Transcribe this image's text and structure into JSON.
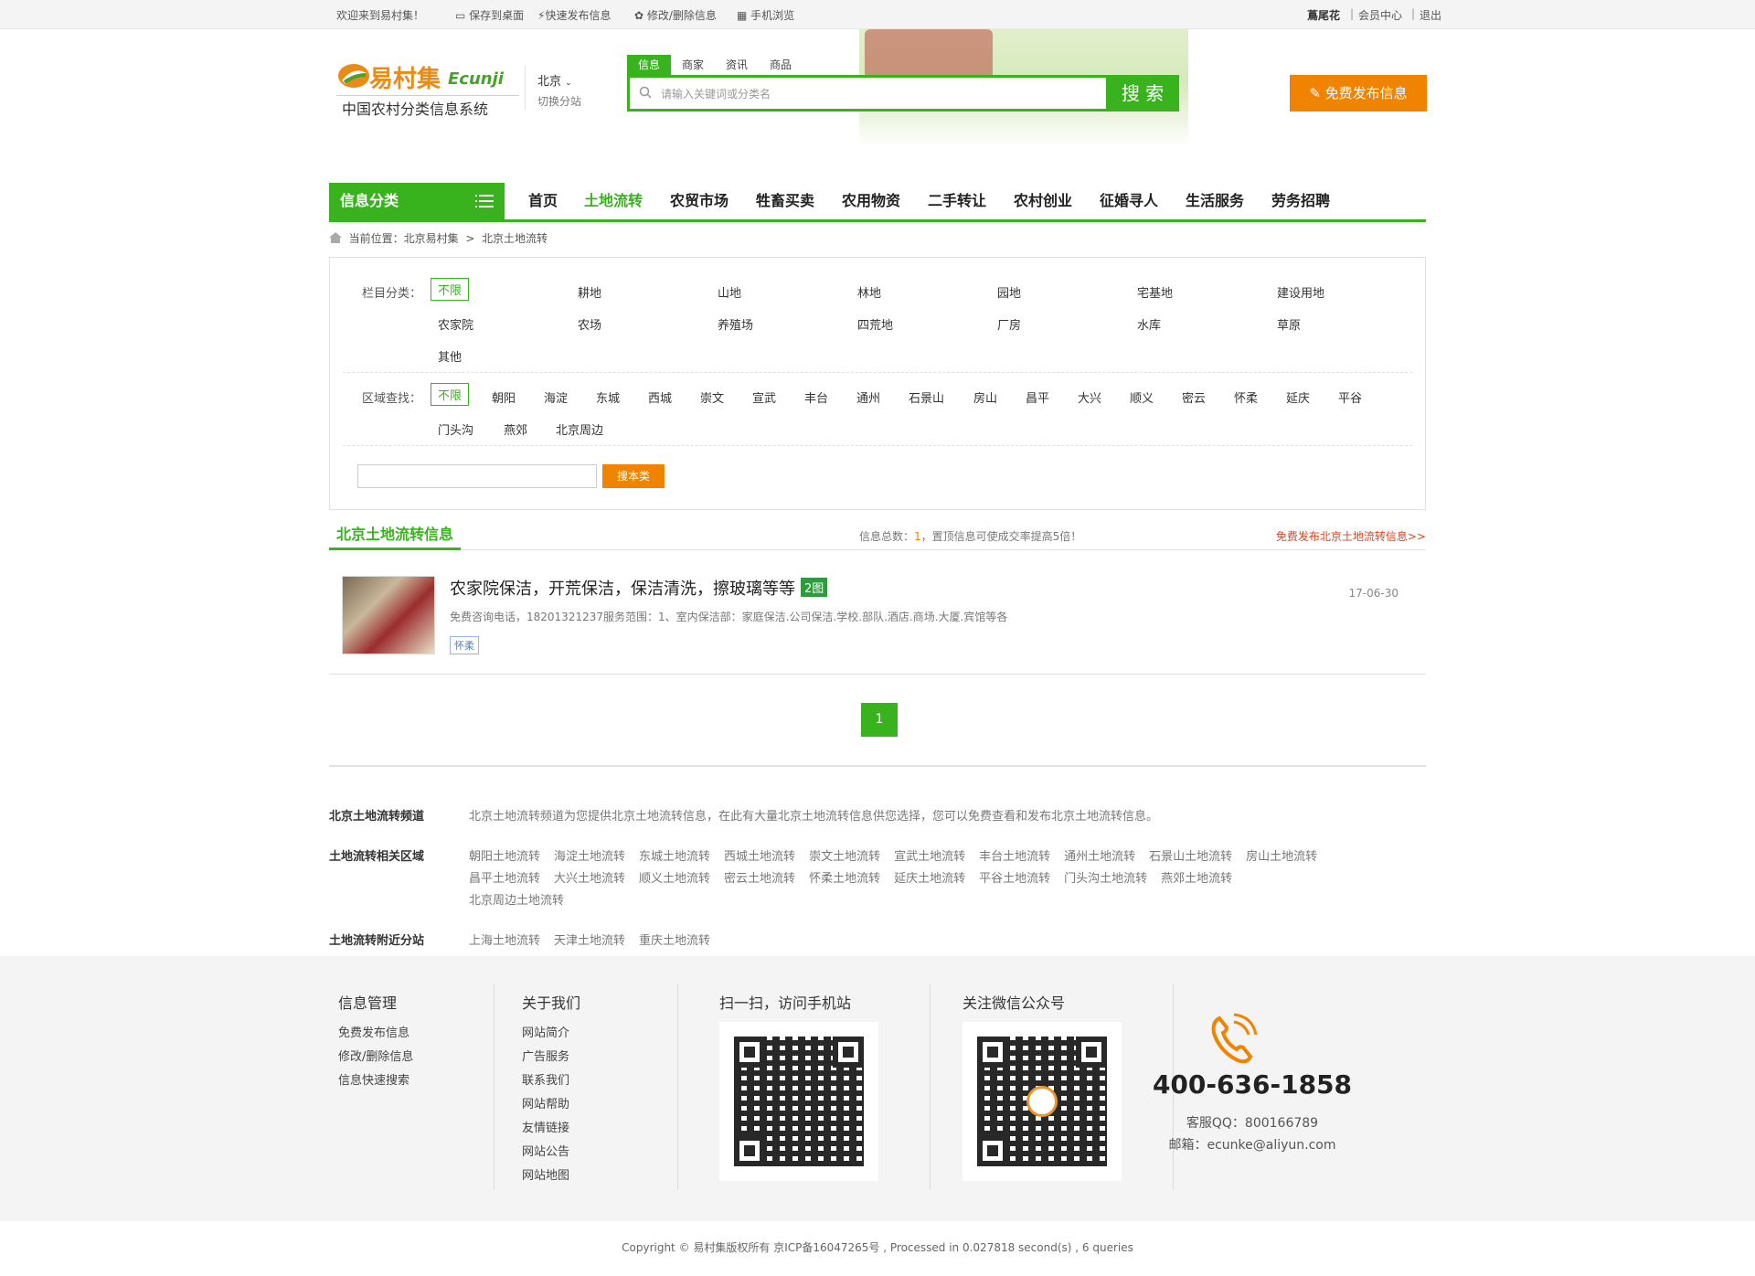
{
  "topbar": {
    "welcome": "欢迎来到易村集！",
    "save": "保存到桌面",
    "quick_post": "快速发布信息",
    "edit": "修改/删除信息",
    "mobile": "手机浏览",
    "user": "蔦尾花",
    "member": "会员中心",
    "logout": "退出",
    "sep1": "|",
    "sep2": "|"
  },
  "header": {
    "logo_cn": "易村集",
    "logo_en": "Ecunji",
    "logo_sub": "中国农村分类信息系统",
    "city": "北京",
    "city_sub": "切换分站",
    "search_tabs": [
      "信息",
      "商家",
      "资讯",
      "商品"
    ],
    "search_placeholder": "请输入关键词或分类名",
    "search_button": "搜 索",
    "publish_button": "免费发布信息"
  },
  "nav": {
    "category_button": "信息分类",
    "items": [
      "首页",
      "土地流转",
      "农贸市场",
      "牲畜买卖",
      "农用物资",
      "二手转让",
      "农村创业",
      "征婚寻人",
      "生活服务",
      "劳务招聘"
    ],
    "active": "土地流转"
  },
  "breadcrumb": {
    "prefix": "当前位置：",
    "home": "北京易村集",
    "arrow": ">",
    "current": "北京土地流转"
  },
  "filter": {
    "cat_label": "栏目分类：",
    "area_label": "区域查找：",
    "unlimited": "不限",
    "categories": [
      "耕地",
      "山地",
      "林地",
      "园地",
      "宅基地",
      "建设用地",
      "农家院",
      "农场",
      "养殖场",
      "四荒地",
      "厂房",
      "水库",
      "草原",
      "其他"
    ],
    "areas": [
      "朝阳",
      "海淀",
      "东城",
      "西城",
      "崇文",
      "宣武",
      "丰台",
      "通州",
      "石景山",
      "房山",
      "昌平",
      "大兴",
      "顺义",
      "密云",
      "怀柔",
      "延庆",
      "平谷",
      "门头沟",
      "燕郊",
      "北京周边"
    ],
    "search_button": "搜本类"
  },
  "list": {
    "title": "北京土地流转信息",
    "stat_prefix": "信息总数：",
    "stat_count": "1",
    "stat_suffix": "，置顶信息可使成交率提高5倍！",
    "free_post": "免费发布北京土地流转信息>>",
    "items": [
      {
        "title": "农家院保洁，开荒保洁，保洁清洗，擦玻璃等等",
        "tag": "2图",
        "desc": "免费咨询电话，18201321237服务范围：1、室内保洁部：家庭保洁.公司保洁.学校.部队.酒店.商场.大厦.宾馆等各",
        "area": "怀柔",
        "date": "17-06-30"
      }
    ]
  },
  "pager": {
    "current": "1"
  },
  "seo": {
    "channel_key": "北京土地流转频道",
    "channel_val": "北京土地流转频道为您提供北京土地流转信息，在此有大量北京土地流转信息供您选择，您可以免费查看和发布北京土地流转信息。",
    "area_key": "土地流转相关区域",
    "area_links": [
      "朝阳土地流转",
      "海淀土地流转",
      "东城土地流转",
      "西城土地流转",
      "崇文土地流转",
      "宣武土地流转",
      "丰台土地流转",
      "通州土地流转",
      "石景山土地流转",
      "房山土地流转",
      "昌平土地流转",
      "大兴土地流转",
      "顺义土地流转",
      "密云土地流转",
      "怀柔土地流转",
      "延庆土地流转",
      "平谷土地流转",
      "门头沟土地流转",
      "燕郊土地流转",
      "北京周边土地流转"
    ],
    "near_key": "土地流转附近分站",
    "near_links": [
      "上海土地流转",
      "天津土地流转",
      "重庆土地流转"
    ]
  },
  "footer": {
    "col1_title": "信息管理",
    "col1": [
      "免费发布信息",
      "修改/删除信息",
      "信息快速搜索"
    ],
    "col2_title": "关于我们",
    "col2": [
      "网站简介",
      "广告服务",
      "联系我们",
      "网站帮助",
      "友情链接",
      "网站公告",
      "网站地图"
    ],
    "qr1_title": "扫一扫，访问手机站",
    "qr2_title": "关注微信公众号",
    "tel": "400-636-1858",
    "qq": "客服QQ：800166789",
    "mail": "邮箱：ecunke@aliyun.com",
    "copyright": "Copyright © 易村集版权所有 京ICP备16047265号 , Processed in 0.027818 second(s) , 6 queries"
  },
  "colors": {
    "green": "#38b21d",
    "orange": "#f08300",
    "red_link": "#e3411c"
  }
}
